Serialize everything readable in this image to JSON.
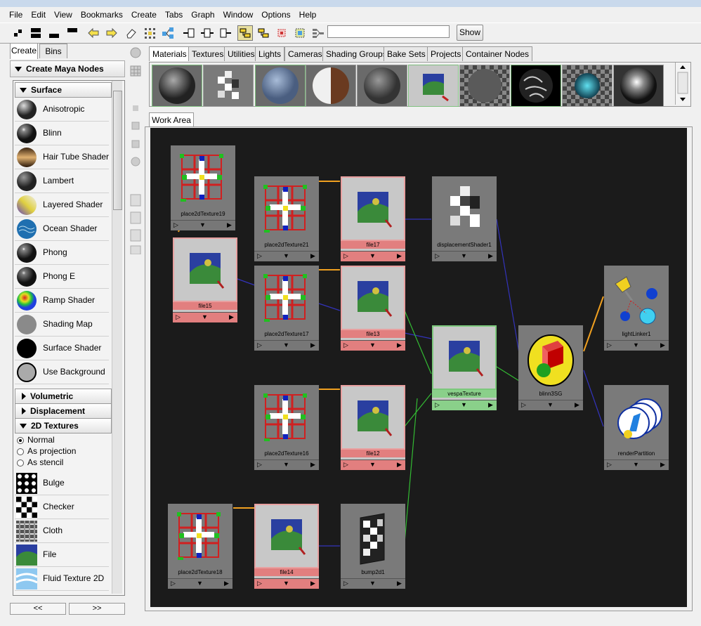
{
  "menubar": {
    "items": [
      "File",
      "Edit",
      "View",
      "Bookmarks",
      "Create",
      "Tabs",
      "Graph",
      "Window",
      "Options",
      "Help"
    ]
  },
  "toolbar": {
    "search_value": "",
    "show_label": "Show"
  },
  "left_panel": {
    "tabs": [
      "Create",
      "Bins"
    ],
    "create_header": "Create Maya Nodes",
    "sections": {
      "surface": "Surface",
      "volumetric": "Volumetric",
      "displacement": "Displacement",
      "textures2d": "2D Textures"
    },
    "surface_items": [
      "Anisotropic",
      "Blinn",
      "Hair Tube Shader",
      "Lambert",
      "Layered Shader",
      "Ocean Shader",
      "Phong",
      "Phong E",
      "Ramp Shader",
      "Shading Map",
      "Surface Shader",
      "Use Background"
    ],
    "radios": [
      "Normal",
      "As projection",
      "As stencil"
    ],
    "texture_items": [
      "Bulge",
      "Checker",
      "Cloth",
      "File",
      "Fluid Texture 2D"
    ],
    "pager": [
      "<<",
      ">>"
    ]
  },
  "swatch_tabs": [
    "Materials",
    "Textures",
    "Utilities",
    "Lights",
    "Cameras",
    "Shading Groups",
    "Bake Sets",
    "Projects",
    "Container Nodes"
  ],
  "work_area": {
    "tab": "Work Area",
    "nodes": {
      "place2dTexture19": "place2dTexture19",
      "place2dTexture21": "place2dTexture21",
      "file17": "file17",
      "displacementShader1": "displacementShader1",
      "file15": "file15",
      "place2dTexture17": "place2dTexture17",
      "file13": "file13",
      "vespaTexture": "vespaTexture",
      "blinn3SG": "blinn3SG",
      "lightLinker1": "lightLinker1",
      "place2dTexture16": "place2dTexture16",
      "file12": "file12",
      "renderPartition": "renderPartition",
      "place2dTexture18": "place2dTexture18",
      "file14": "file14",
      "bump2d1": "bump2d1"
    }
  },
  "colors": {
    "work_bg": "#1b1b1b",
    "node_gray": "#7a7a7a",
    "file_label": "#e27f7f",
    "selected_label": "#8ad08a",
    "conn_orange": "#f0a020",
    "conn_blue": "#3333bb",
    "conn_green": "#33bb33"
  }
}
